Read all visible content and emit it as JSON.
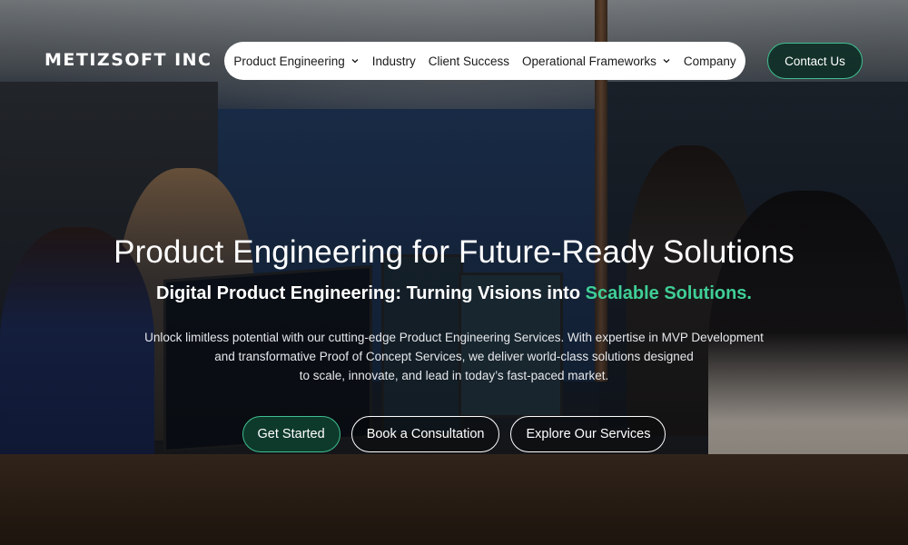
{
  "brand": {
    "logo_text": "METIZSOFT INC"
  },
  "nav": {
    "items": [
      {
        "label": "Product Engineering",
        "has_dropdown": true
      },
      {
        "label": "Industry",
        "has_dropdown": false
      },
      {
        "label": "Client Success",
        "has_dropdown": false
      },
      {
        "label": "Operational Frameworks",
        "has_dropdown": true
      },
      {
        "label": "Company",
        "has_dropdown": false
      }
    ],
    "contact_label": "Contact Us"
  },
  "hero": {
    "title": "Product Engineering for Future-Ready Solutions",
    "subtitle_prefix": "Digital Product Engineering: Turning Visions into ",
    "subtitle_accent": "Scalable Solutions.",
    "description_lines": [
      "Unlock limitless potential with our cutting-edge Product Engineering Services. With expertise in MVP Development",
      "and transformative Proof of Concept Services, we deliver world-class solutions designed",
      "to scale, innovate, and lead in today’s fast-paced market."
    ],
    "buttons": {
      "get_started": "Get Started",
      "book_consultation": "Book a Consultation",
      "explore_services": "Explore Our Services"
    }
  },
  "colors": {
    "accent_green": "#3fcf97",
    "primary_button_bg": "#0e3a2c",
    "nav_bg": "#ffffff"
  },
  "icons": {
    "dropdown": "chevron-down-icon"
  }
}
